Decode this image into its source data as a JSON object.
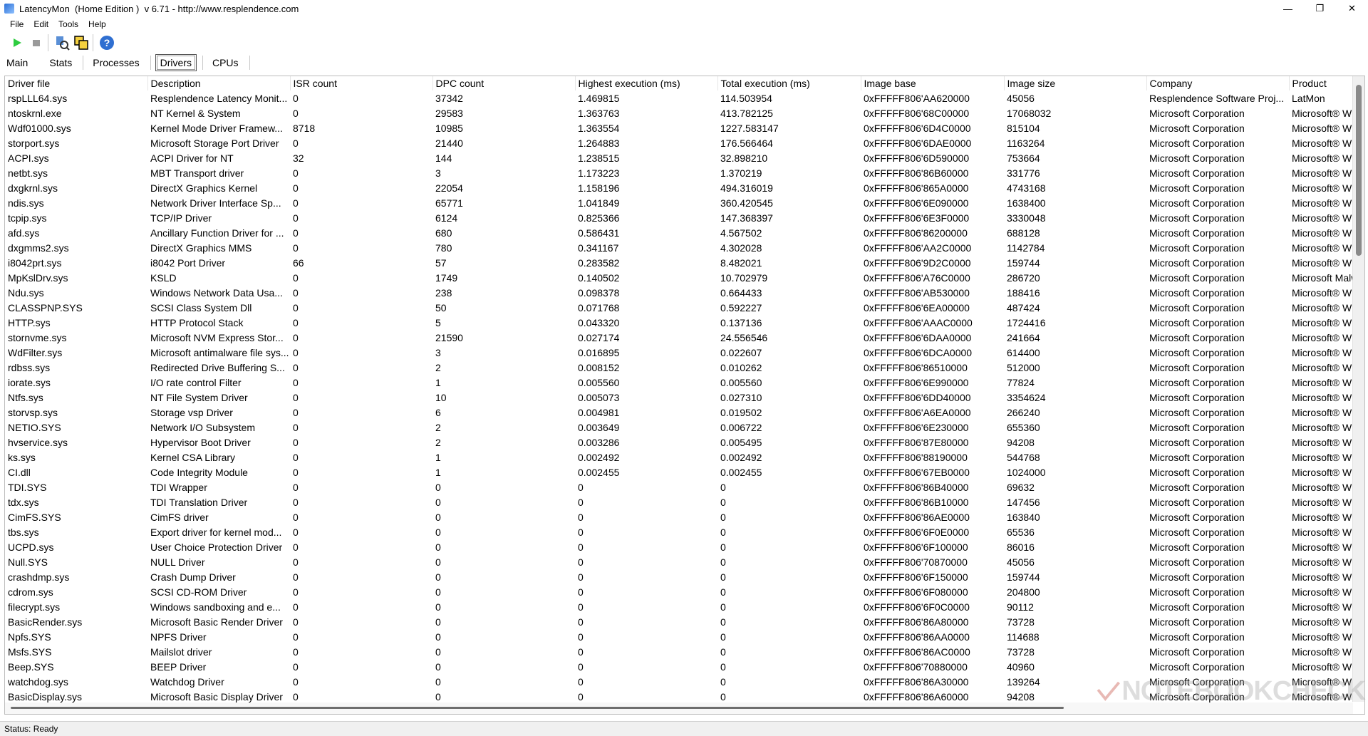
{
  "window": {
    "title": "LatencyMon  (Home Edition )  v 6.71 - http://www.resplendence.com",
    "minimize": "—",
    "maximize": "❐",
    "close": "✕"
  },
  "menu": {
    "items": [
      "File",
      "Edit",
      "Tools",
      "Help"
    ]
  },
  "toolbar": {
    "play_icon": "play-icon",
    "stop_icon": "stop-icon",
    "tool1_icon": "analyze-icon",
    "tool2_icon": "windows-icon",
    "help_icon": "help-icon"
  },
  "tabs": [
    {
      "label": "Main"
    },
    {
      "label": "Stats"
    },
    {
      "label": "Processes"
    },
    {
      "label": "Drivers"
    },
    {
      "label": "CPUs"
    }
  ],
  "table": {
    "columns": [
      "Driver file",
      "Description",
      "ISR count",
      "DPC count",
      "Highest execution (ms)",
      "Total execution (ms)",
      "Image base",
      "Image size",
      "Company",
      "Product"
    ],
    "rows": [
      [
        "rspLLL64.sys",
        "Resplendence Latency Monit...",
        "0",
        "37342",
        "1.469815",
        "114.503954",
        "0xFFFFF806'AA620000",
        "45056",
        "Resplendence Software Proj...",
        "LatMon"
      ],
      [
        "ntoskrnl.exe",
        "NT Kernel & System",
        "0",
        "29583",
        "1.363763",
        "413.782125",
        "0xFFFFF806'68C00000",
        "17068032",
        "Microsoft Corporation",
        "Microsoft® W"
      ],
      [
        "Wdf01000.sys",
        "Kernel Mode Driver Framew...",
        "8718",
        "10985",
        "1.363554",
        "1227.583147",
        "0xFFFFF806'6D4C0000",
        "815104",
        "Microsoft Corporation",
        "Microsoft® W"
      ],
      [
        "storport.sys",
        "Microsoft Storage Port Driver",
        "0",
        "21440",
        "1.264883",
        "176.566464",
        "0xFFFFF806'6DAE0000",
        "1163264",
        "Microsoft Corporation",
        "Microsoft® W"
      ],
      [
        "ACPI.sys",
        "ACPI Driver for NT",
        "32",
        "144",
        "1.238515",
        "32.898210",
        "0xFFFFF806'6D590000",
        "753664",
        "Microsoft Corporation",
        "Microsoft® W"
      ],
      [
        "netbt.sys",
        "MBT Transport driver",
        "0",
        "3",
        "1.173223",
        "1.370219",
        "0xFFFFF806'86B60000",
        "331776",
        "Microsoft Corporation",
        "Microsoft® W"
      ],
      [
        "dxgkrnl.sys",
        "DirectX Graphics Kernel",
        "0",
        "22054",
        "1.158196",
        "494.316019",
        "0xFFFFF806'865A0000",
        "4743168",
        "Microsoft Corporation",
        "Microsoft® W"
      ],
      [
        "ndis.sys",
        "Network Driver Interface Sp...",
        "0",
        "65771",
        "1.041849",
        "360.420545",
        "0xFFFFF806'6E090000",
        "1638400",
        "Microsoft Corporation",
        "Microsoft® W"
      ],
      [
        "tcpip.sys",
        "TCP/IP Driver",
        "0",
        "6124",
        "0.825366",
        "147.368397",
        "0xFFFFF806'6E3F0000",
        "3330048",
        "Microsoft Corporation",
        "Microsoft® W"
      ],
      [
        "afd.sys",
        "Ancillary Function Driver for ...",
        "0",
        "680",
        "0.586431",
        "4.567502",
        "0xFFFFF806'86200000",
        "688128",
        "Microsoft Corporation",
        "Microsoft® W"
      ],
      [
        "dxgmms2.sys",
        "DirectX Graphics MMS",
        "0",
        "780",
        "0.341167",
        "4.302028",
        "0xFFFFF806'AA2C0000",
        "1142784",
        "Microsoft Corporation",
        "Microsoft® W"
      ],
      [
        "i8042prt.sys",
        "i8042 Port Driver",
        "66",
        "57",
        "0.283582",
        "8.482021",
        "0xFFFFF806'9D2C0000",
        "159744",
        "Microsoft Corporation",
        "Microsoft® W"
      ],
      [
        "MpKslDrv.sys",
        "KSLD",
        "0",
        "1749",
        "0.140502",
        "10.702979",
        "0xFFFFF806'A76C0000",
        "286720",
        "Microsoft Corporation",
        "Microsoft Malw"
      ],
      [
        "Ndu.sys",
        "Windows Network Data Usa...",
        "0",
        "238",
        "0.098378",
        "0.664433",
        "0xFFFFF806'AB530000",
        "188416",
        "Microsoft Corporation",
        "Microsoft® W"
      ],
      [
        "CLASSPNP.SYS",
        "SCSI Class System Dll",
        "0",
        "50",
        "0.071768",
        "0.592227",
        "0xFFFFF806'6EA00000",
        "487424",
        "Microsoft Corporation",
        "Microsoft® W"
      ],
      [
        "HTTP.sys",
        "HTTP Protocol Stack",
        "0",
        "5",
        "0.043320",
        "0.137136",
        "0xFFFFF806'AAAC0000",
        "1724416",
        "Microsoft Corporation",
        "Microsoft® W"
      ],
      [
        "stornvme.sys",
        "Microsoft NVM Express Stor...",
        "0",
        "21590",
        "0.027174",
        "24.556546",
        "0xFFFFF806'6DAA0000",
        "241664",
        "Microsoft Corporation",
        "Microsoft® W"
      ],
      [
        "WdFilter.sys",
        "Microsoft antimalware file sys...",
        "0",
        "3",
        "0.016895",
        "0.022607",
        "0xFFFFF806'6DCA0000",
        "614400",
        "Microsoft Corporation",
        "Microsoft® W"
      ],
      [
        "rdbss.sys",
        "Redirected Drive Buffering S...",
        "0",
        "2",
        "0.008152",
        "0.010262",
        "0xFFFFF806'86510000",
        "512000",
        "Microsoft Corporation",
        "Microsoft® W"
      ],
      [
        "iorate.sys",
        "I/O rate control Filter",
        "0",
        "1",
        "0.005560",
        "0.005560",
        "0xFFFFF806'6E990000",
        "77824",
        "Microsoft Corporation",
        "Microsoft® W"
      ],
      [
        "Ntfs.sys",
        "NT File System Driver",
        "0",
        "10",
        "0.005073",
        "0.027310",
        "0xFFFFF806'6DD40000",
        "3354624",
        "Microsoft Corporation",
        "Microsoft® W"
      ],
      [
        "storvsp.sys",
        "Storage vsp Driver",
        "0",
        "6",
        "0.004981",
        "0.019502",
        "0xFFFFF806'A6EA0000",
        "266240",
        "Microsoft Corporation",
        "Microsoft® W"
      ],
      [
        "NETIO.SYS",
        "Network I/O Subsystem",
        "0",
        "2",
        "0.003649",
        "0.006722",
        "0xFFFFF806'6E230000",
        "655360",
        "Microsoft Corporation",
        "Microsoft® W"
      ],
      [
        "hvservice.sys",
        "Hypervisor Boot Driver",
        "0",
        "2",
        "0.003286",
        "0.005495",
        "0xFFFFF806'87E80000",
        "94208",
        "Microsoft Corporation",
        "Microsoft® W"
      ],
      [
        "ks.sys",
        "Kernel CSA Library",
        "0",
        "1",
        "0.002492",
        "0.002492",
        "0xFFFFF806'88190000",
        "544768",
        "Microsoft Corporation",
        "Microsoft® W"
      ],
      [
        "CI.dll",
        "Code Integrity Module",
        "0",
        "1",
        "0.002455",
        "0.002455",
        "0xFFFFF806'67EB0000",
        "1024000",
        "Microsoft Corporation",
        "Microsoft® W"
      ],
      [
        "TDI.SYS",
        "TDI Wrapper",
        "0",
        "0",
        "0",
        "0",
        "0xFFFFF806'86B40000",
        "69632",
        "Microsoft Corporation",
        "Microsoft® W"
      ],
      [
        "tdx.sys",
        "TDI Translation Driver",
        "0",
        "0",
        "0",
        "0",
        "0xFFFFF806'86B10000",
        "147456",
        "Microsoft Corporation",
        "Microsoft® W"
      ],
      [
        "CimFS.SYS",
        "CimFS driver",
        "0",
        "0",
        "0",
        "0",
        "0xFFFFF806'86AE0000",
        "163840",
        "Microsoft Corporation",
        "Microsoft® W"
      ],
      [
        "tbs.sys",
        "Export driver for kernel mod...",
        "0",
        "0",
        "0",
        "0",
        "0xFFFFF806'6F0E0000",
        "65536",
        "Microsoft Corporation",
        "Microsoft® W"
      ],
      [
        "UCPD.sys",
        "User Choice Protection Driver",
        "0",
        "0",
        "0",
        "0",
        "0xFFFFF806'6F100000",
        "86016",
        "Microsoft Corporation",
        "Microsoft® W"
      ],
      [
        "Null.SYS",
        "NULL Driver",
        "0",
        "0",
        "0",
        "0",
        "0xFFFFF806'70870000",
        "45056",
        "Microsoft Corporation",
        "Microsoft® W"
      ],
      [
        "crashdmp.sys",
        "Crash Dump Driver",
        "0",
        "0",
        "0",
        "0",
        "0xFFFFF806'6F150000",
        "159744",
        "Microsoft Corporation",
        "Microsoft® W"
      ],
      [
        "cdrom.sys",
        "SCSI CD-ROM Driver",
        "0",
        "0",
        "0",
        "0",
        "0xFFFFF806'6F080000",
        "204800",
        "Microsoft Corporation",
        "Microsoft® W"
      ],
      [
        "filecrypt.sys",
        "Windows sandboxing and e...",
        "0",
        "0",
        "0",
        "0",
        "0xFFFFF806'6F0C0000",
        "90112",
        "Microsoft Corporation",
        "Microsoft® W"
      ],
      [
        "BasicRender.sys",
        "Microsoft Basic Render Driver",
        "0",
        "0",
        "0",
        "0",
        "0xFFFFF806'86A80000",
        "73728",
        "Microsoft Corporation",
        "Microsoft® W"
      ],
      [
        "Npfs.SYS",
        "NPFS Driver",
        "0",
        "0",
        "0",
        "0",
        "0xFFFFF806'86AA0000",
        "114688",
        "Microsoft Corporation",
        "Microsoft® W"
      ],
      [
        "Msfs.SYS",
        "Mailslot driver",
        "0",
        "0",
        "0",
        "0",
        "0xFFFFF806'86AC0000",
        "73728",
        "Microsoft Corporation",
        "Microsoft® W"
      ],
      [
        "Beep.SYS",
        "BEEP Driver",
        "0",
        "0",
        "0",
        "0",
        "0xFFFFF806'70880000",
        "40960",
        "Microsoft Corporation",
        "Microsoft® W"
      ],
      [
        "watchdog.sys",
        "Watchdog Driver",
        "0",
        "0",
        "0",
        "0",
        "0xFFFFF806'86A30000",
        "139264",
        "Microsoft Corporation",
        "Microsoft® W"
      ],
      [
        "BasicDisplay.sys",
        "Microsoft Basic Display Driver",
        "0",
        "0",
        "0",
        "0",
        "0xFFFFF806'86A60000",
        "94208",
        "Microsoft Corporation",
        "Microsoft® W"
      ]
    ]
  },
  "status": {
    "text": "Status: Ready"
  },
  "watermark": {
    "text": "NOTEBOOKCHECK"
  }
}
